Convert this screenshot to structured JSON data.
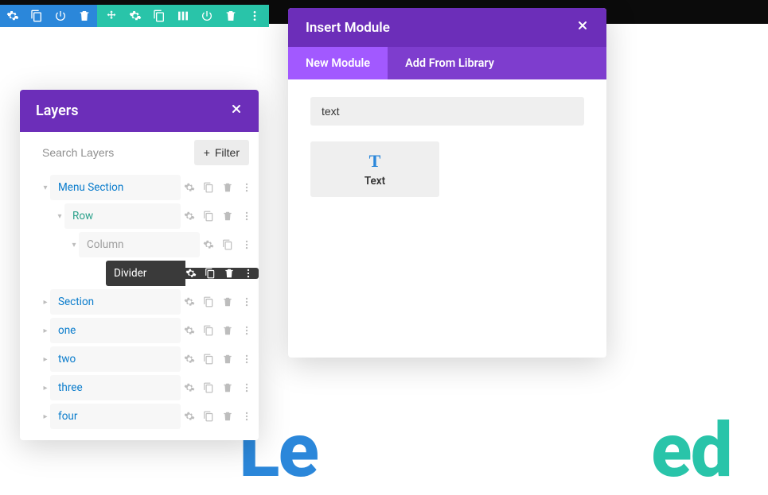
{
  "toolbar_blue": {
    "icons": [
      "gear-icon",
      "duplicate-icon",
      "power-icon",
      "trash-icon"
    ]
  },
  "toolbar_teal": {
    "icons": [
      "move-icon",
      "gear-icon",
      "duplicate-icon",
      "columns-icon",
      "power-icon",
      "trash-icon",
      "more-icon"
    ]
  },
  "layers_panel": {
    "title": "Layers",
    "search_placeholder": "Search Layers",
    "filter_label": "Filter",
    "items": [
      {
        "label": "Menu Section",
        "expanded": true,
        "indent": 0,
        "type": "section",
        "actions": [
          "gear",
          "dup",
          "trash",
          "more"
        ]
      },
      {
        "label": "Row",
        "expanded": true,
        "indent": 1,
        "type": "row",
        "actions": [
          "gear",
          "dup",
          "trash",
          "more"
        ]
      },
      {
        "label": "Column",
        "expanded": true,
        "indent": 2,
        "type": "column",
        "actions": [
          "gear",
          "dup",
          "more"
        ]
      },
      {
        "label": "Divider",
        "expanded": false,
        "indent": 3,
        "type": "module-active",
        "actions": [
          "gear",
          "dup",
          "trash",
          "more"
        ]
      },
      {
        "label": "Section",
        "expanded": false,
        "indent": 0,
        "type": "section-collapsed",
        "actions": [
          "gear",
          "dup",
          "trash",
          "more"
        ]
      },
      {
        "label": "one",
        "expanded": false,
        "indent": 0,
        "type": "section-collapsed",
        "actions": [
          "gear",
          "dup",
          "trash",
          "more"
        ]
      },
      {
        "label": "two",
        "expanded": false,
        "indent": 0,
        "type": "section-collapsed",
        "actions": [
          "gear",
          "dup",
          "trash",
          "more"
        ]
      },
      {
        "label": "three",
        "expanded": false,
        "indent": 0,
        "type": "section-collapsed",
        "actions": [
          "gear",
          "dup",
          "trash",
          "more"
        ]
      },
      {
        "label": "four",
        "expanded": false,
        "indent": 0,
        "type": "section-collapsed",
        "actions": [
          "gear",
          "dup",
          "trash",
          "more"
        ]
      }
    ]
  },
  "insert_panel": {
    "title": "Insert Module",
    "tabs": [
      {
        "label": "New Module",
        "active": true
      },
      {
        "label": "Add From Library",
        "active": false
      }
    ],
    "search_value": "text",
    "modules": [
      {
        "icon": "T",
        "label": "Text"
      }
    ]
  },
  "background_text": {
    "part1": "Le",
    "part2": "ed"
  }
}
